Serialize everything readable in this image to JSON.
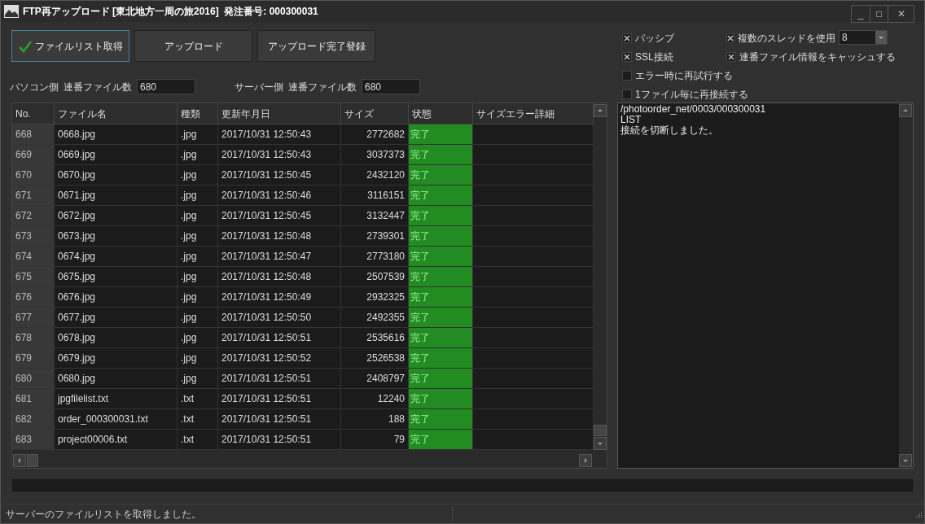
{
  "window": {
    "title": "FTP再アップロード [東北地方一周の旅2016]  発注番号: 000300031",
    "controls": [
      "_",
      "□",
      "✕"
    ]
  },
  "buttons": [
    {
      "label": "ファイルリスト取得",
      "done": true
    },
    {
      "label": "アップロード",
      "done": false
    },
    {
      "label": "アップロード完了登録",
      "done": false
    }
  ],
  "counts": [
    {
      "side": "パソコン側",
      "label": "連番ファイル数",
      "value": "680"
    },
    {
      "side": "サーバー側",
      "label": "連番ファイル数",
      "value": "680"
    }
  ],
  "options": [
    {
      "label": "パッシブ",
      "checked": true
    },
    {
      "label": "複数のスレッドを使用",
      "checked": true
    },
    {
      "label": "SSL接続",
      "checked": true
    },
    {
      "label": "連番ファイル情報をキャッシュする",
      "checked": true
    },
    {
      "label": "エラー時に再試行する",
      "checked": false
    },
    {
      "label": "1ファイル毎に再接続する",
      "checked": false
    }
  ],
  "threads": {
    "value": "8"
  },
  "table": {
    "columns": [
      "No.",
      "ファイル名",
      "種類",
      "更新年月日",
      "サイズ",
      "状態",
      "サイズエラー詳細"
    ],
    "rows": [
      {
        "no": "668",
        "name": "0668.jpg",
        "type": ".jpg",
        "date": "2017/10/31 12:50:43",
        "size": "2772682",
        "state": "完了",
        "kind": "done"
      },
      {
        "no": "669",
        "name": "0669.jpg",
        "type": ".jpg",
        "date": "2017/10/31 12:50:43",
        "size": "3037373",
        "state": "完了",
        "kind": "done"
      },
      {
        "no": "670",
        "name": "0670.jpg",
        "type": ".jpg",
        "date": "2017/10/31 12:50:45",
        "size": "2432120",
        "state": "完了",
        "kind": "done"
      },
      {
        "no": "671",
        "name": "0671.jpg",
        "type": ".jpg",
        "date": "2017/10/31 12:50:46",
        "size": "3116151",
        "state": "完了",
        "kind": "done"
      },
      {
        "no": "672",
        "name": "0672.jpg",
        "type": ".jpg",
        "date": "2017/10/31 12:50:45",
        "size": "3132447",
        "state": "完了",
        "kind": "done"
      },
      {
        "no": "673",
        "name": "0673.jpg",
        "type": ".jpg",
        "date": "2017/10/31 12:50:48",
        "size": "2739301",
        "state": "完了",
        "kind": "done"
      },
      {
        "no": "674",
        "name": "0674.jpg",
        "type": ".jpg",
        "date": "2017/10/31 12:50:47",
        "size": "2773180",
        "state": "完了",
        "kind": "done"
      },
      {
        "no": "675",
        "name": "0675.jpg",
        "type": ".jpg",
        "date": "2017/10/31 12:50:48",
        "size": "2507539",
        "state": "完了",
        "kind": "done"
      },
      {
        "no": "676",
        "name": "0676.jpg",
        "type": ".jpg",
        "date": "2017/10/31 12:50:49",
        "size": "2932325",
        "state": "完了",
        "kind": "done"
      },
      {
        "no": "677",
        "name": "0677.jpg",
        "type": ".jpg",
        "date": "2017/10/31 12:50:50",
        "size": "2492355",
        "state": "完了",
        "kind": "done"
      },
      {
        "no": "678",
        "name": "0678.jpg",
        "type": ".jpg",
        "date": "2017/10/31 12:50:51",
        "size": "2535616",
        "state": "完了",
        "kind": "done"
      },
      {
        "no": "679",
        "name": "0679.jpg",
        "type": ".jpg",
        "date": "2017/10/31 12:50:52",
        "size": "2526538",
        "state": "完了",
        "kind": "done"
      },
      {
        "no": "680",
        "name": "0680.jpg",
        "type": ".jpg",
        "date": "2017/10/31 12:50:51",
        "size": "2408797",
        "state": "完了",
        "kind": "done"
      },
      {
        "no": "681",
        "name": "jpgfilelist.txt",
        "type": ".txt",
        "date": "2017/10/31 12:50:51",
        "size": "12240",
        "state": "完了",
        "kind": "done"
      },
      {
        "no": "682",
        "name": "order_000300031.txt",
        "type": ".txt",
        "date": "2017/10/31 12:50:51",
        "size": "188",
        "state": "完了",
        "kind": "done"
      },
      {
        "no": "683",
        "name": "project00006.txt",
        "type": ".txt",
        "date": "2017/10/31 12:50:51",
        "size": "79",
        "state": "完了",
        "kind": "done"
      }
    ]
  },
  "log": [
    "/photoorder_net/0003/000300031",
    "LIST",
    "接続を切断しました。"
  ],
  "progress": {
    "level": 0
  },
  "status_bar": "サーバーのファイルリストを取得しました。"
}
